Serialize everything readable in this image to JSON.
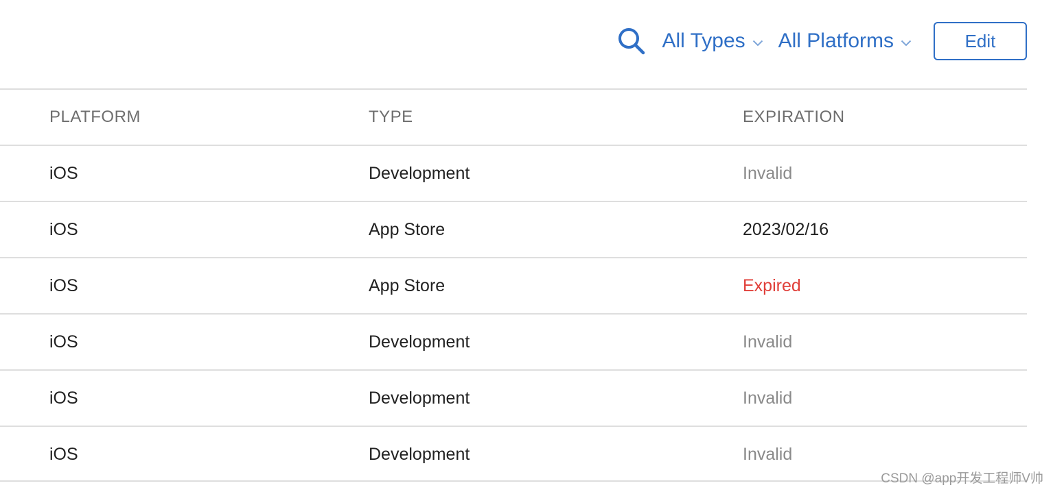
{
  "toolbar": {
    "search_icon": "search-icon",
    "types_filter": "All Types",
    "platforms_filter": "All Platforms",
    "edit_label": "Edit"
  },
  "colors": {
    "accent": "#2f6fc6",
    "expired": "#e0403a",
    "invalid": "#8a8a8a"
  },
  "table": {
    "headers": [
      "PLATFORM",
      "TYPE",
      "EXPIRATION"
    ],
    "rows": [
      {
        "platform": "iOS",
        "type": "Development",
        "expiration": "Invalid",
        "status": "invalid"
      },
      {
        "platform": "iOS",
        "type": "App Store",
        "expiration": "2023/02/16",
        "status": "date"
      },
      {
        "platform": "iOS",
        "type": "App Store",
        "expiration": "Expired",
        "status": "expired"
      },
      {
        "platform": "iOS",
        "type": "Development",
        "expiration": "Invalid",
        "status": "invalid"
      },
      {
        "platform": "iOS",
        "type": "Development",
        "expiration": "Invalid",
        "status": "invalid"
      },
      {
        "platform": "iOS",
        "type": "Development",
        "expiration": "Invalid",
        "status": "invalid"
      }
    ]
  },
  "watermark": "CSDN @app开发工程师V帅"
}
